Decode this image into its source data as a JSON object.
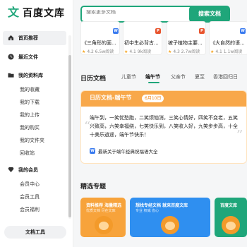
{
  "sidebar": {
    "logo_text": "百度文库",
    "items": [
      {
        "label": "首页推荐",
        "active": true,
        "icon": "home-icon"
      },
      {
        "label": "最近文件",
        "icon": "clock-icon"
      },
      {
        "label": "我的资料库",
        "icon": "folder-icon"
      }
    ],
    "library_subitems": [
      "我的收藏",
      "我的下载",
      "我的上传",
      "我的购买",
      "我的文件夹",
      "回收站"
    ],
    "member": {
      "label": "我的会员",
      "icon": "diamond-icon"
    },
    "member_subitems": [
      "会员中心",
      "会员工具",
      "会员福利"
    ],
    "doc_tools_label": "文档工具"
  },
  "search": {
    "placeholder": "搜索更多文档",
    "button_label": "搜索文档"
  },
  "top_docs": [
    {
      "title": "《三角形的面...",
      "rating": "4.2",
      "reads": "6.5w阅读",
      "badge": "W",
      "badge_color": "#3a7bef"
    },
    {
      "title": "初中生必背古...",
      "rating": "4.1",
      "reads": "9k阅读",
      "badge": "P",
      "badge_color": "#e8542e"
    },
    {
      "title": "被子植物主要...",
      "rating": "4.3",
      "reads": "2.7w阅读",
      "badge": "P",
      "badge_color": "#e8542e"
    },
    {
      "title": "《大自然的语...",
      "rating": "4.1",
      "reads": "1.1w阅读",
      "badge": "W",
      "badge_color": "#3a7bef"
    }
  ],
  "calendar": {
    "title": "日历文档",
    "tabs": [
      "儿童节",
      "端午节",
      "父亲节",
      "夏至",
      "香港回归日"
    ],
    "active_tab": "端午节"
  },
  "festival_card": {
    "title": "日历文档-端午节",
    "date": "6月10日",
    "body": "端午到，一笑忧愁跑，二笑烦恼消，三笑心情好，四笑不变老，五笑兴致高，六笑幸福绕，七笑快乐到，八笑收入好，九笑步步高，十全十美乐逍遥，端午节快乐！",
    "link_badge": "W",
    "link_text": "最新关于端午经典祝福语大全"
  },
  "topics": {
    "title": "精选专题",
    "cards": [
      {
        "caption": "资料推荐 海量精选",
        "sub": "优质文档 尽在文库",
        "color": "#f7a33b"
      },
      {
        "caption": "想找专经文档 就来百度文库",
        "sub": "专业 权威 省心",
        "color": "#2f8ff0"
      },
      {
        "caption": "百度文库",
        "sub": "",
        "color": "#1fa67a"
      }
    ]
  },
  "colors": {
    "accent": "#1fa67a",
    "festival": "#f8a84a",
    "star": "#f5a623"
  }
}
